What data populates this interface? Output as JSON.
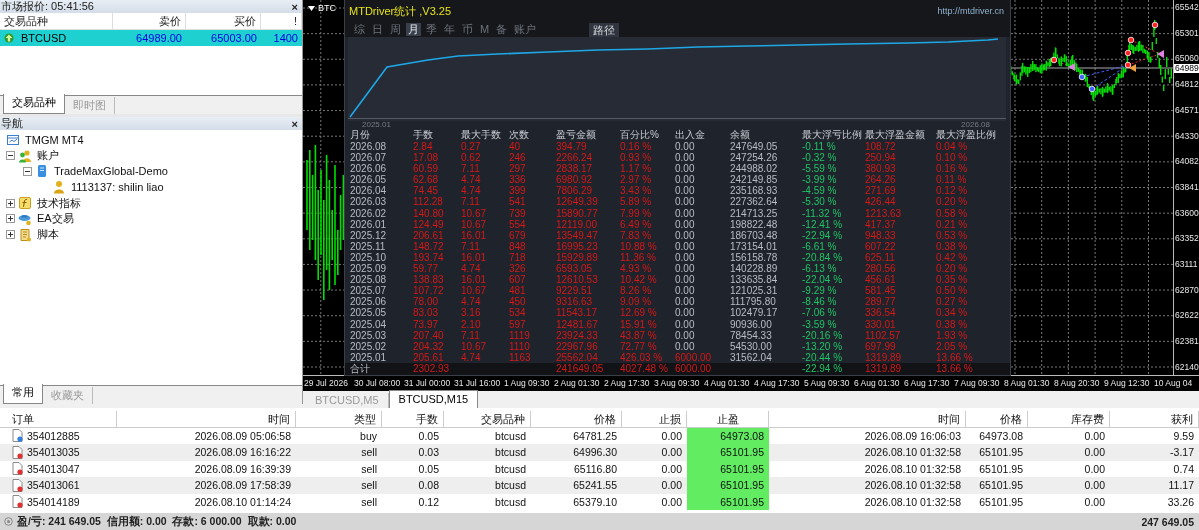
{
  "market_watch": {
    "title": "市场报价: 05:41:56",
    "close": "×",
    "columns": [
      "交易品种",
      "卖价",
      "买价",
      "!"
    ],
    "rows": [
      {
        "symbol": "BTCUSD",
        "bid": "64989.00",
        "ask": "65003.00",
        "spread": "1400",
        "selected": true
      }
    ],
    "tabs": [
      {
        "label": "交易品种",
        "selected": true
      },
      {
        "label": "即时图",
        "selected": false
      }
    ]
  },
  "navigator": {
    "title": "导航",
    "close": "×",
    "tree": [
      {
        "label": "TMGM MT4",
        "kind": "terminal",
        "children": [
          {
            "label": "账户",
            "kind": "accounts",
            "expanded": true,
            "children": [
              {
                "label": "TradeMaxGlobal-Demo",
                "kind": "server",
                "expanded": true,
                "children": [
                  {
                    "label": "1113137: shilin liao",
                    "kind": "account"
                  }
                ]
              }
            ]
          },
          {
            "label": "技术指标",
            "kind": "indicators",
            "expanded": false
          },
          {
            "label": "EA交易",
            "kind": "experts",
            "expanded": false
          },
          {
            "label": "脚本",
            "kind": "scripts",
            "expanded": false
          }
        ]
      }
    ],
    "tabs": [
      {
        "label": "常用",
        "selected": true
      },
      {
        "label": "收藏夹",
        "selected": false
      }
    ]
  },
  "chart": {
    "symbol_label": "BTC",
    "price_axis": [
      "65542",
      "65301",
      "65060",
      "64812",
      "64571",
      "64330",
      "64082",
      "63841",
      "63600",
      "63352",
      "63111",
      "62870",
      "62622",
      "62381",
      "62140"
    ],
    "current_price": "64989",
    "time_axis": [
      "29 Jul 2026",
      "30 Jul 08:00",
      "31 Jul 00:00",
      "31 Jul 16:00",
      "1 Aug 09:30",
      "2 Aug 01:30",
      "2 Aug 17:30",
      "3 Aug 09:30",
      "4 Aug 01:30",
      "4 Aug 17:30",
      "5 Aug 09:30",
      "6 Aug 01:30",
      "6 Aug 17:30",
      "7 Aug 09:30",
      "8 Aug 01:30",
      "8 Aug 20:30",
      "9 Aug 12:30",
      "10 Aug 04"
    ],
    "tabs": [
      {
        "label": "BTCUSD,M5",
        "selected": false
      },
      {
        "label": "BTCUSD,M15",
        "selected": true
      }
    ]
  },
  "stats_panel": {
    "title": "MTDriver统计 ,V3.25",
    "url": "http://mtdriver.cn",
    "tabs": [
      {
        "label": "综",
        "selected": false
      },
      {
        "label": "日",
        "selected": false
      },
      {
        "label": "周",
        "selected": false
      },
      {
        "label": "月",
        "selected": true
      },
      {
        "label": "季",
        "selected": false
      },
      {
        "label": "年",
        "selected": false
      },
      {
        "label": "币",
        "selected": false
      },
      {
        "label": "M",
        "selected": false
      },
      {
        "label": "备",
        "selected": false
      },
      {
        "label": "账户",
        "selected": false
      }
    ],
    "path_button": "路径",
    "equity_chart": {
      "start_label": "2025.01",
      "end_label": "2026.08"
    },
    "columns": [
      "月份",
      "手数",
      "最大手数",
      "次数",
      "盈亏金额",
      "百分比%",
      "出入金",
      "余额",
      "最大浮亏比例",
      "最大浮盈金额",
      "最大浮盈比例"
    ],
    "rows": [
      {
        "cells": [
          "2026.08",
          "2.84",
          "0.27",
          "40",
          "394.79",
          "0.16 %",
          "0.00",
          "247649.05",
          "-0.11 %",
          "108.72",
          "0.04 %"
        ],
        "deposit_highlighted": false
      },
      {
        "cells": [
          "2026.07",
          "17.08",
          "0.62",
          "246",
          "2266.24",
          "0.93 %",
          "0.00",
          "247254.26",
          "-0.32 %",
          "250.94",
          "0.10 %"
        ],
        "deposit_highlighted": false
      },
      {
        "cells": [
          "2026.06",
          "60.59",
          "7.11",
          "297",
          "2838.17",
          "1.17 %",
          "0.00",
          "244988.02",
          "-5.59 %",
          "380.93",
          "0.16 %"
        ],
        "deposit_highlighted": false
      },
      {
        "cells": [
          "2026.05",
          "62.68",
          "4.74",
          "336",
          "6980.92",
          "2.97 %",
          "0.00",
          "242149.85",
          "-3.99 %",
          "264.26",
          "0.11 %"
        ],
        "deposit_highlighted": false
      },
      {
        "cells": [
          "2026.04",
          "74.45",
          "4.74",
          "399",
          "7806.29",
          "3.43 %",
          "0.00",
          "235168.93",
          "-4.59 %",
          "271.69",
          "0.12 %"
        ],
        "deposit_highlighted": false
      },
      {
        "cells": [
          "2026.03",
          "112.28",
          "7.11",
          "541",
          "12649.39",
          "5.89 %",
          "0.00",
          "227362.64",
          "-5.30 %",
          "426.44",
          "0.20 %"
        ],
        "deposit_highlighted": false
      },
      {
        "cells": [
          "2026.02",
          "140.80",
          "10.67",
          "739",
          "15890.77",
          "7.99 %",
          "0.00",
          "214713.25",
          "-11.32 %",
          "1213.63",
          "0.58 %"
        ],
        "deposit_highlighted": false
      },
      {
        "cells": [
          "2026.01",
          "124.49",
          "10.67",
          "554",
          "12119.00",
          "6.49 %",
          "0.00",
          "198822.48",
          "-12.41 %",
          "417.37",
          "0.21 %"
        ],
        "deposit_highlighted": false
      },
      {
        "cells": [
          "2025.12",
          "206.61",
          "16.01",
          "679",
          "13549.47",
          "7.83 %",
          "0.00",
          "186703.48",
          "-22.94 %",
          "948.33",
          "0.53 %"
        ],
        "deposit_highlighted": false
      },
      {
        "cells": [
          "2025.11",
          "148.72",
          "7.11",
          "848",
          "16995.23",
          "10.88 %",
          "0.00",
          "173154.01",
          "-6.61 %",
          "607.22",
          "0.38 %"
        ],
        "deposit_highlighted": false
      },
      {
        "cells": [
          "2025.10",
          "193.74",
          "16.01",
          "718",
          "15929.89",
          "11.36 %",
          "0.00",
          "156158.78",
          "-20.84 %",
          "625.11",
          "0.42 %"
        ],
        "deposit_highlighted": false
      },
      {
        "cells": [
          "2025.09",
          "59.77",
          "4.74",
          "326",
          "6593.05",
          "4.93 %",
          "0.00",
          "140228.89",
          "-6.13 %",
          "280.56",
          "0.20 %"
        ],
        "deposit_highlighted": false
      },
      {
        "cells": [
          "2025.08",
          "138.83",
          "16.01",
          "607",
          "12610.53",
          "10.42 %",
          "0.00",
          "133635.84",
          "-22.04 %",
          "456.61",
          "0.35 %"
        ],
        "deposit_highlighted": false
      },
      {
        "cells": [
          "2025.07",
          "107.72",
          "10.67",
          "481",
          "9229.51",
          "8.26 %",
          "0.00",
          "121025.31",
          "-9.29 %",
          "581.45",
          "0.50 %"
        ],
        "deposit_highlighted": false
      },
      {
        "cells": [
          "2025.06",
          "78.00",
          "4.74",
          "450",
          "9316.63",
          "9.09 %",
          "0.00",
          "111795.80",
          "-8.46 %",
          "289.77",
          "0.27 %"
        ],
        "deposit_highlighted": false
      },
      {
        "cells": [
          "2025.05",
          "83.03",
          "3.16",
          "534",
          "11543.17",
          "12.69 %",
          "0.00",
          "102479.17",
          "-7.06 %",
          "336.54",
          "0.34 %"
        ],
        "deposit_highlighted": false
      },
      {
        "cells": [
          "2025.04",
          "73.97",
          "2.10",
          "597",
          "12481.67",
          "15.91 %",
          "0.00",
          "90936.00",
          "-3.59 %",
          "330.01",
          "0.38 %"
        ],
        "deposit_highlighted": false
      },
      {
        "cells": [
          "2025.03",
          "207.40",
          "7.11",
          "1119",
          "23924.33",
          "43.87 %",
          "0.00",
          "78454.33",
          "-20.16 %",
          "1102.57",
          "1.93 %"
        ],
        "deposit_highlighted": false
      },
      {
        "cells": [
          "2025.02",
          "204.32",
          "10.67",
          "1110",
          "22967.96",
          "72.77 %",
          "0.00",
          "54530.00",
          "-13.20 %",
          "697.99",
          "2.05 %"
        ],
        "deposit_highlighted": false
      },
      {
        "cells": [
          "2025.01",
          "205.61",
          "4.74",
          "1163",
          "25562.04",
          "426.03 %",
          "6000.00",
          "31562.04",
          "-20.44 %",
          "1319.89",
          "13.66 %"
        ],
        "deposit_highlighted": true
      }
    ],
    "total": {
      "cells": [
        "合计",
        "2302.93",
        null,
        null,
        "241649.05",
        "4027.48 %",
        "6000.00",
        null,
        "-22.94 %",
        "1319.89",
        "13.66 %"
      ],
      "deposit_highlighted": true
    }
  },
  "terminal": {
    "columns": [
      "订单",
      "时间",
      "类型",
      "手数",
      "交易品种",
      "价格",
      "止损",
      "止盈",
      "时间",
      "价格",
      "库存费",
      "获利"
    ],
    "orders": [
      {
        "kind": "buy",
        "cells": [
          "354012885",
          "2026.08.09 05:06:58",
          "buy",
          "0.05",
          "btcusd",
          "64781.25",
          "0.00",
          "64973.08",
          "2026.08.09 16:06:03",
          "64973.08",
          "0.00",
          "9.59"
        ]
      },
      {
        "kind": "sell",
        "cells": [
          "354013035",
          "2026.08.09 16:16:22",
          "sell",
          "0.03",
          "btcusd",
          "64996.30",
          "0.00",
          "65101.95",
          "2026.08.10 01:32:58",
          "65101.95",
          "0.00",
          "-3.17"
        ]
      },
      {
        "kind": "sell",
        "cells": [
          "354013047",
          "2026.08.09 16:39:39",
          "sell",
          "0.05",
          "btcusd",
          "65116.80",
          "0.00",
          "65101.95",
          "2026.08.10 01:32:58",
          "65101.95",
          "0.00",
          "0.74"
        ]
      },
      {
        "kind": "sell",
        "cells": [
          "354013061",
          "2026.08.09 17:58:39",
          "sell",
          "0.08",
          "btcusd",
          "65241.55",
          "0.00",
          "65101.95",
          "2026.08.10 01:32:58",
          "65101.95",
          "0.00",
          "11.17"
        ]
      },
      {
        "kind": "sell",
        "cells": [
          "354014189",
          "2026.08.10 01:14:24",
          "sell",
          "0.12",
          "btcusd",
          "65379.10",
          "0.00",
          "65101.95",
          "2026.08.10 01:32:58",
          "65101.95",
          "0.00",
          "33.26"
        ]
      }
    ],
    "summary": "盈/亏: 241 649.05  信用额: 0.00  存款: 6 000.00  取款: 0.00",
    "summary_total": "247 649.05"
  }
}
